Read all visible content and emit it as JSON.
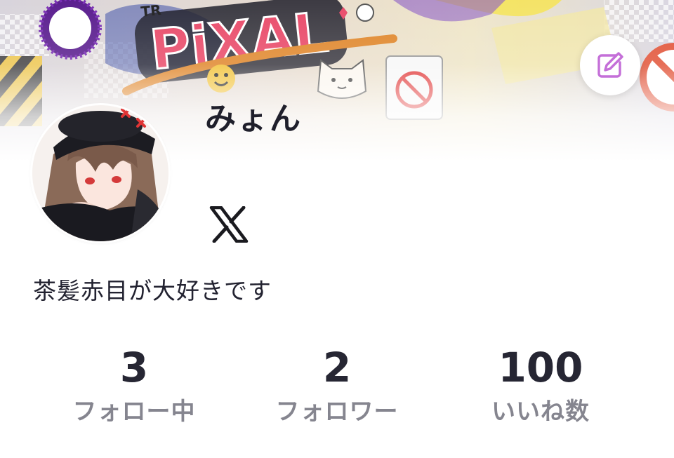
{
  "banner": {
    "logo_text": "PiXAL",
    "logo_tag": "TR"
  },
  "profile": {
    "display_name": "みょん",
    "bio": "茶髪赤目が大好きです",
    "social_icon": "x-logo-icon"
  },
  "actions": {
    "edit_icon": "edit-pencil-icon"
  },
  "stats": [
    {
      "value": "3",
      "label": "フォロー中"
    },
    {
      "value": "2",
      "label": "フォロワー"
    },
    {
      "value": "100",
      "label": "いいね数"
    }
  ],
  "colors": {
    "accent": "#c46fd8",
    "text_primary": "#1f1f2b",
    "text_secondary": "#85858f"
  }
}
